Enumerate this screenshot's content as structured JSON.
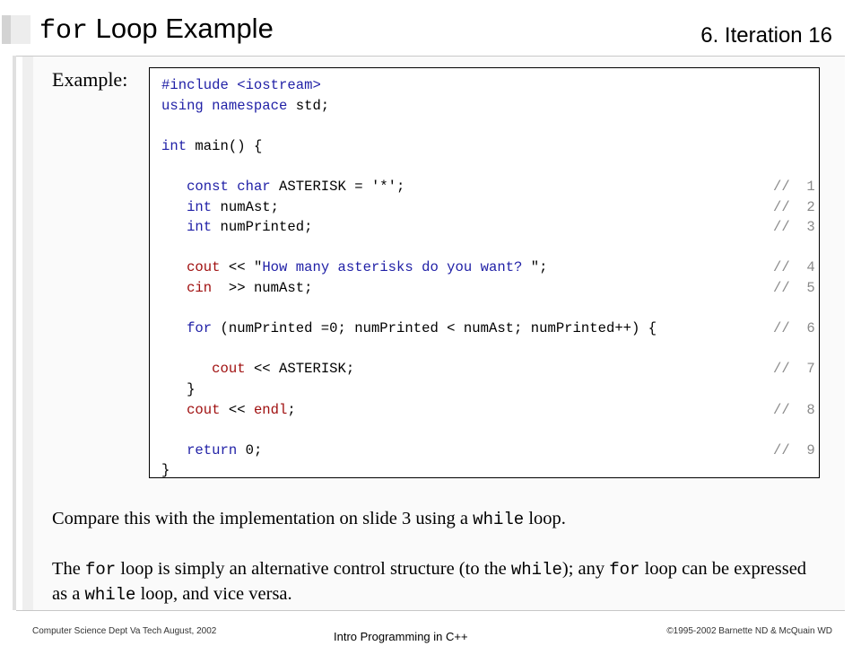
{
  "header": {
    "title_keyword": "for",
    "title_rest": " Loop Example",
    "slide_id": "6. Iteration  16"
  },
  "example_label": "Example:",
  "code": {
    "lines": [
      [
        {
          "t": "#include <iostream>",
          "c": "pp"
        }
      ],
      [
        {
          "t": "using namespace",
          "c": "kw"
        },
        {
          "t": " std;",
          "c": ""
        }
      ],
      [
        {
          "t": "",
          "c": ""
        }
      ],
      [
        {
          "t": "int",
          "c": "kw"
        },
        {
          "t": " main() {",
          "c": ""
        }
      ],
      [
        {
          "t": "",
          "c": ""
        }
      ],
      [
        {
          "t": "   ",
          "c": ""
        },
        {
          "t": "const char",
          "c": "kw"
        },
        {
          "t": " ASTERISK = '*';",
          "c": ""
        }
      ],
      [
        {
          "t": "   ",
          "c": ""
        },
        {
          "t": "int",
          "c": "kw"
        },
        {
          "t": " numAst;",
          "c": ""
        }
      ],
      [
        {
          "t": "   ",
          "c": ""
        },
        {
          "t": "int",
          "c": "kw"
        },
        {
          "t": " numPrinted;",
          "c": ""
        }
      ],
      [
        {
          "t": "",
          "c": ""
        }
      ],
      [
        {
          "t": "   ",
          "c": ""
        },
        {
          "t": "cout",
          "c": "fn"
        },
        {
          "t": " << \"",
          "c": ""
        },
        {
          "t": "How many asterisks do you want? ",
          "c": "str"
        },
        {
          "t": "\";",
          "c": ""
        }
      ],
      [
        {
          "t": "   ",
          "c": ""
        },
        {
          "t": "cin",
          "c": "fn"
        },
        {
          "t": "  >> numAst;",
          "c": ""
        }
      ],
      [
        {
          "t": "",
          "c": ""
        }
      ],
      [
        {
          "t": "   ",
          "c": ""
        },
        {
          "t": "for",
          "c": "kw"
        },
        {
          "t": " (numPrinted =0; numPrinted < numAst; numPrinted++) {",
          "c": ""
        }
      ],
      [
        {
          "t": "",
          "c": ""
        }
      ],
      [
        {
          "t": "      ",
          "c": ""
        },
        {
          "t": "cout",
          "c": "fn"
        },
        {
          "t": " << ASTERISK;",
          "c": ""
        }
      ],
      [
        {
          "t": "   }",
          "c": ""
        }
      ],
      [
        {
          "t": "   ",
          "c": ""
        },
        {
          "t": "cout",
          "c": "fn"
        },
        {
          "t": " << ",
          "c": ""
        },
        {
          "t": "endl",
          "c": "fn"
        },
        {
          "t": ";",
          "c": ""
        }
      ],
      [
        {
          "t": "",
          "c": ""
        }
      ],
      [
        {
          "t": "   ",
          "c": ""
        },
        {
          "t": "return",
          "c": "kw"
        },
        {
          "t": " 0;",
          "c": ""
        }
      ],
      [
        {
          "t": "}",
          "c": ""
        }
      ]
    ],
    "comments": [
      "",
      "",
      "",
      "",
      "",
      "//  1",
      "//  2",
      "//  3",
      "",
      "//  4",
      "//  5",
      "",
      "//  6",
      "",
      "//  7",
      "",
      "//  8",
      "",
      "//  9",
      ""
    ]
  },
  "para1": {
    "a": "Compare this with the implementation on slide 3 using a ",
    "code": "while",
    "b": " loop."
  },
  "para2": {
    "a": "The ",
    "code1": "for",
    "b": " loop is simply an alternative control structure (to the ",
    "code2": "while",
    "c": ");   any ",
    "code3": "for",
    "d": " loop can be expressed as a ",
    "code4": "while",
    "e": " loop, and vice versa."
  },
  "footer": {
    "left": "Computer Science Dept Va Tech  August, 2002",
    "center": "Intro Programming in C++",
    "right": "©1995-2002  Barnette ND & McQuain WD"
  },
  "colors": {
    "keyword": "#1f1fa6",
    "identifier": "#a01010",
    "comment": "#8a8a8a"
  }
}
